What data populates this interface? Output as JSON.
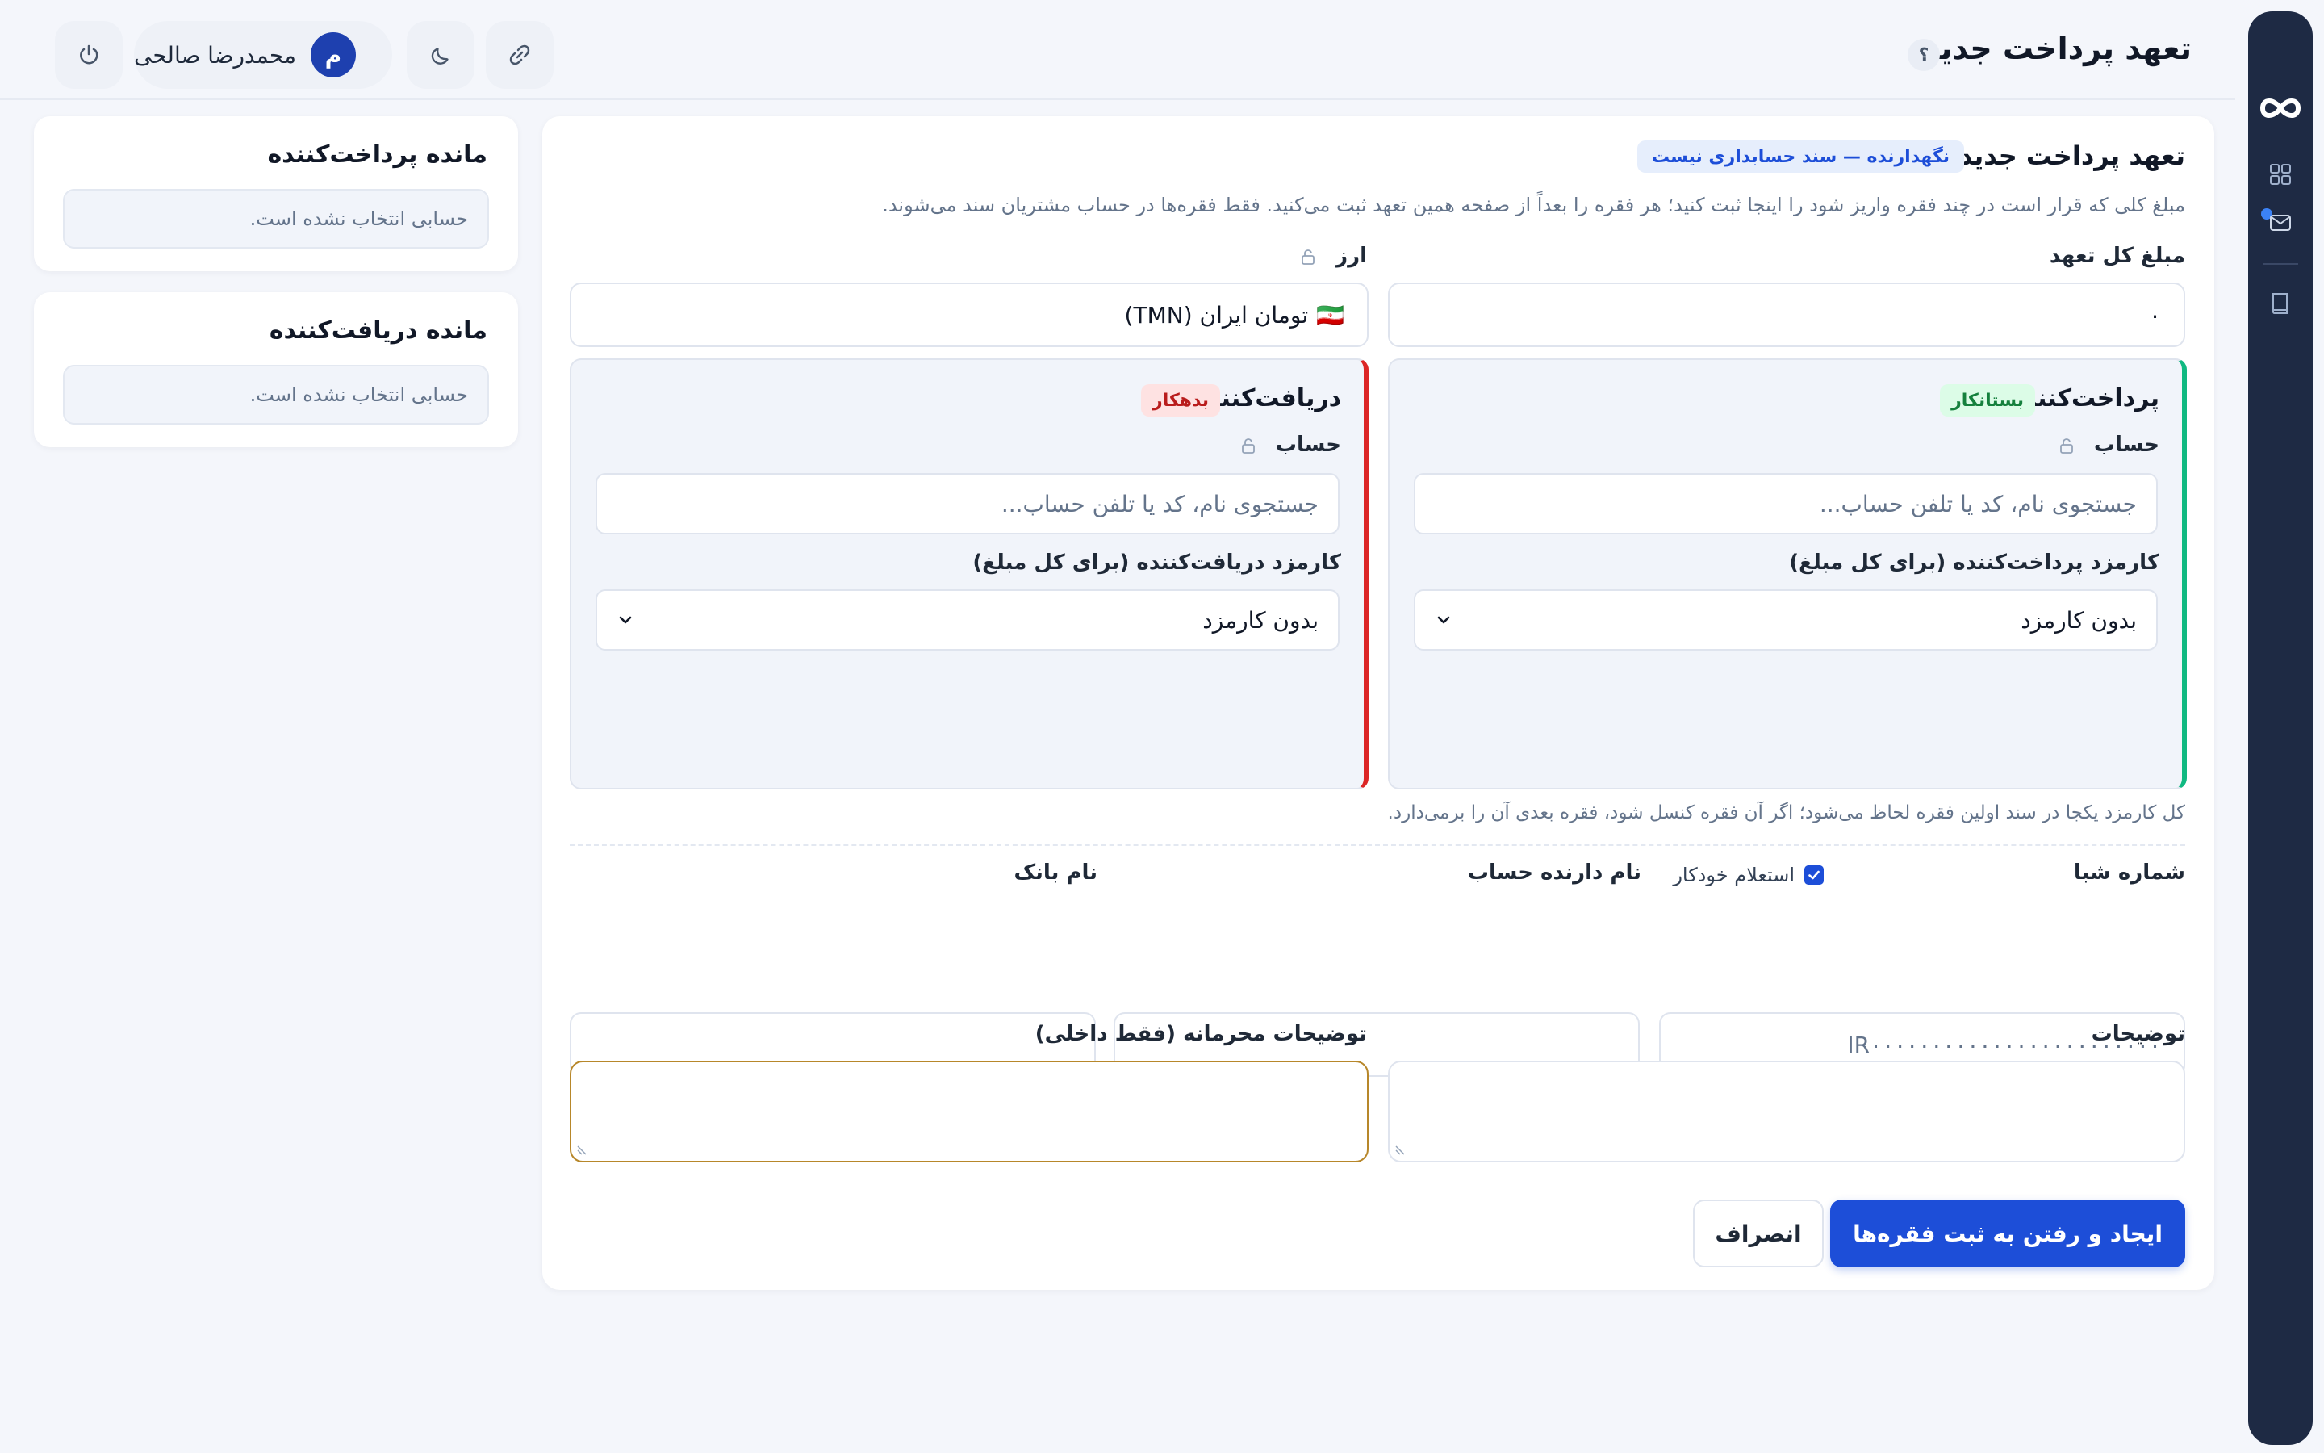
{
  "header": {
    "title": "تعهد پرداخت جدید",
    "help": "؟",
    "user_name": "محمدرضا صالحی",
    "user_initial": "م"
  },
  "side": {
    "payer_balance_title": "مانده پرداخت‌کننده",
    "payer_balance_empty": "حسابی انتخاب نشده است.",
    "payee_balance_title": "مانده دریافت‌کننده",
    "payee_balance_empty": "حسابی انتخاب نشده است."
  },
  "form": {
    "title": "تعهد پرداخت جدید",
    "badge": "نگهدارنده — سند حسابداری نیست",
    "description": "مبلغ کلی که قرار است در چند فقره واریز شود را اینجا ثبت کنید؛ هر فقره را بعداً از صفحه همین تعهد ثبت می‌کنید. فقط فقره‌ها در حساب مشتریان سند می‌شوند.",
    "amount_label": "مبلغ کل تعهد",
    "amount_value": "۰",
    "currency_label": "ارز",
    "currency_flag": "🇮🇷",
    "currency_value": "تومان ایران (TMN)",
    "payer": {
      "title": "پرداخت‌کننده",
      "badge": "بستانکار",
      "account_label": "حساب",
      "account_placeholder": "جستجوی نام، کد یا تلفن حساب...",
      "fee_label": "کارمزد پرداخت‌کننده (برای کل مبلغ)",
      "fee_value": "بدون کارمزد"
    },
    "payee": {
      "title": "دریافت‌کننده",
      "badge": "بدهکار",
      "account_label": "حساب",
      "account_placeholder": "جستجوی نام، کد یا تلفن حساب...",
      "fee_label": "کارمزد دریافت‌کننده (برای کل مبلغ)",
      "fee_value": "بدون کارمزد"
    },
    "fee_note": "کل کارمزد یکجا در سند اولین فقره لحاظ می‌شود؛ اگر آن فقره کنسل شود، فقره بعدی آن را برمی‌دارد.",
    "iban_label": "شماره شبا",
    "auto_inquiry_label": "استعلام خودکار",
    "iban_placeholder": "IR۰۰۰۰۰۰۰۰۰۰۰۰۰۰۰۰۰۰۰۰۰۰۰۰",
    "holder_label": "نام دارنده حساب",
    "bank_label": "نام بانک",
    "notes_label": "توضیحات",
    "private_notes_label": "توضیحات محرمانه (فقط داخلی)",
    "submit_label": "ایجاد و رفتن به ثبت فقره‌ها",
    "cancel_label": "انصراف"
  },
  "colors": {
    "primary": "#1d4ed8",
    "payer_accent": "#10b981",
    "payee_accent": "#dc2626",
    "sidebar": "#1e2a44"
  },
  "icons": [
    "infinity-logo-icon",
    "grid-icon",
    "envelope-icon",
    "book-icon",
    "help-icon",
    "link-icon",
    "moon-icon",
    "power-icon",
    "lock-icon",
    "chevron-down-icon",
    "checkmark-icon"
  ]
}
